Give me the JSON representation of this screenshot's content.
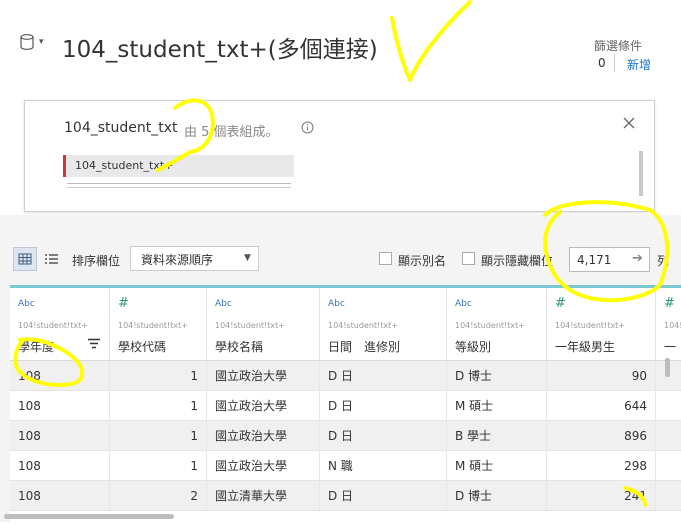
{
  "header": {
    "title": "104_student_txt+(多個連接)",
    "filters_label": "篩選條件",
    "filters_count": "0",
    "add_filter": "新增"
  },
  "connection": {
    "name": "104_student_txt",
    "description": "由 5 個表組成。",
    "table": "104_student_txt+"
  },
  "toolbar": {
    "sort_label": "排序欄位",
    "sort_value": "資料來源順序",
    "show_alias": "顯示別名",
    "show_hidden": "顯示隱藏欄位",
    "row_count": "4,171",
    "rows_label": "列"
  },
  "columns": [
    {
      "type": "Abc",
      "source": "104!student!txt+",
      "name": "學年度"
    },
    {
      "type": "#",
      "source": "104!student!txt+",
      "name": "學校代碼"
    },
    {
      "type": "Abc",
      "source": "104!student!txt+",
      "name": "學校名稱"
    },
    {
      "type": "Abc",
      "source": "104!student!txt+",
      "name": "日間　進修別"
    },
    {
      "type": "Abc",
      "source": "104!student!txt+",
      "name": "等級別"
    },
    {
      "type": "#",
      "source": "104!student!txt+",
      "name": "一年級男生"
    },
    {
      "type": "#",
      "source": "104!student!txt+",
      "name": "一"
    }
  ],
  "rows": [
    [
      "108",
      "1",
      "國立政治大學",
      "D 日",
      "D 博士",
      "90"
    ],
    [
      "108",
      "1",
      "國立政治大學",
      "D 日",
      "M 碩士",
      "644"
    ],
    [
      "108",
      "1",
      "國立政治大學",
      "D 日",
      "B 學士",
      "896"
    ],
    [
      "108",
      "1",
      "國立政治大學",
      "N 職",
      "M 碩士",
      "298"
    ],
    [
      "108",
      "2",
      "國立清華大學",
      "D 日",
      "D 博士",
      "241"
    ]
  ],
  "colors": {
    "accent": "#1a73c8",
    "highlight": "#ffff00",
    "grid_top": "#7ac8d4"
  }
}
